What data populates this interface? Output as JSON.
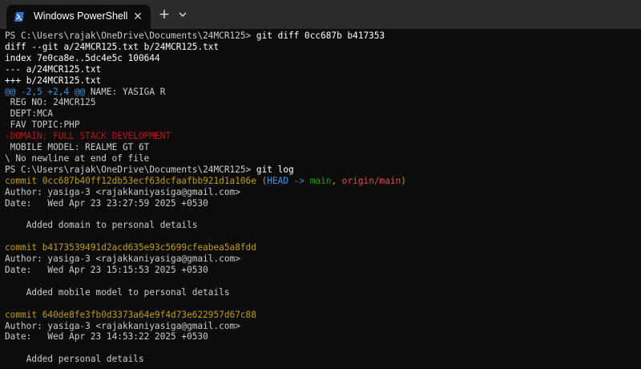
{
  "window": {
    "tab_title": "Windows PowerShell",
    "close_glyph": "✕",
    "new_tab_glyph": "+"
  },
  "colors": {
    "background": "#0c0c0c",
    "titlebar": "#2b2b2b",
    "text": "#cccccc",
    "commit_hash": "#c19c00",
    "hunk_header": "#3a96dd",
    "removed_line": "#c50f1f",
    "branch_head": "#13a10e",
    "remote_branch": "#e74856"
  },
  "terminal": {
    "prompt1": "PS C:\\Users\\rajak\\OneDrive\\Documents\\24MCR125>",
    "cmd1": "git diff 0cc687b b417353",
    "diff_header": "diff --git a/24MCR125.txt b/24MCR125.txt",
    "index_line": "index 7e0ca8e..5dc4e5c 100644",
    "old_file": "--- a/24MCR125.txt",
    "new_file": "+++ b/24MCR125.txt",
    "hunk_header": "@@ -2,5 +2,4 @@",
    "hunk_context": " NAME: YASIGA R",
    "ctx1": " REG NO: 24MCR125",
    "ctx2": " DEPT:MCA",
    "ctx3": " FAV TOPIC:PHP",
    "removed": "-DOMAIN: FULL STACK DEVELOPMENT",
    "ctx4": " MOBILE MODEL: REALME GT 6T",
    "no_newline": "\\ No newline at end of file",
    "prompt2": "PS C:\\Users\\rajak\\OneDrive\\Documents\\24MCR125>",
    "cmd2": "git log",
    "commits": [
      {
        "commit_line": "commit 0cc687b40ff12db53ecf63dcfaafbb921d1a106e",
        "ref_open": " (",
        "head": "HEAD -> ",
        "branch": "main",
        "sep": ", ",
        "remote": "origin/main",
        "ref_close": ")",
        "author": "Author: yasiga-3 <rajakkaniyasiga@gmail.com>",
        "date": "Date:   Wed Apr 23 23:27:59 2025 +0530",
        "message": "    Added domain to personal details"
      },
      {
        "commit_line": "commit b4173539491d2acd635e93c5699cfeabea5a8fdd",
        "author": "Author: yasiga-3 <rajakkaniyasiga@gmail.com>",
        "date": "Date:   Wed Apr 23 15:15:53 2025 +0530",
        "message": "    Added mobile model to personal details"
      },
      {
        "commit_line": "commit 640de8fe3fb0d3373a64e9f4d73e622957d67c88",
        "author": "Author: yasiga-3 <rajakkaniyasiga@gmail.com>",
        "date": "Date:   Wed Apr 23 14:53:22 2025 +0530",
        "message": "    Added personal details"
      }
    ]
  }
}
